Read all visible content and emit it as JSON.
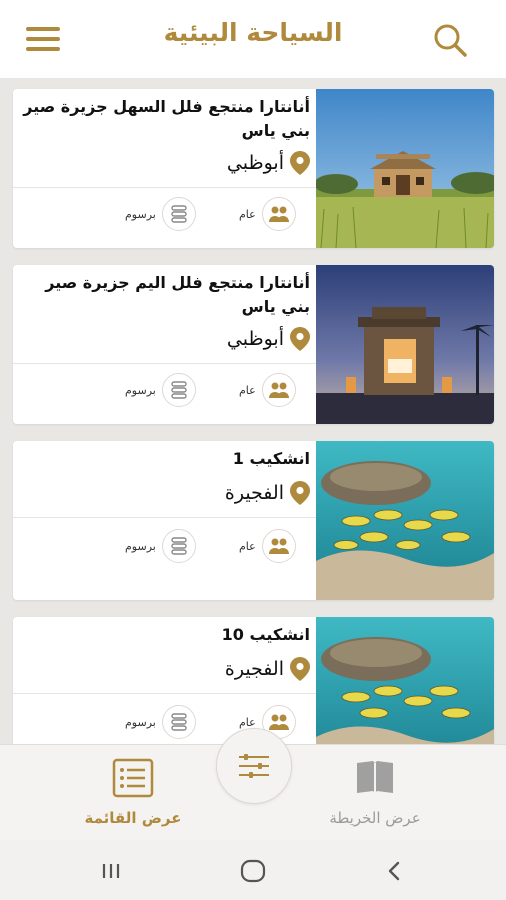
{
  "header": {
    "title": "السياحة البيئية"
  },
  "places": [
    {
      "name": "أنانتارا منتجع فلل السهل جزيرة صير بني ياس",
      "location": "أبوظبي",
      "access": "عام",
      "fees": "برسوم",
      "photo": "desert-villa-day"
    },
    {
      "name": "أنانتارا منتجع فلل اليم جزيرة صير بني ياس",
      "location": "أبوظبي",
      "access": "عام",
      "fees": "برسوم",
      "photo": "beach-villa-night"
    },
    {
      "name": "انشكيب 1",
      "location": "الفجيرة",
      "access": "عام",
      "fees": "برسوم",
      "photo": "coral-reef-fish"
    },
    {
      "name": "انشكيب 10",
      "location": "الفجيرة",
      "access": "عام",
      "fees": "برسوم",
      "photo": "coral-reef-fish"
    }
  ],
  "bottom_tabs": {
    "list_view": "عرض القائمة",
    "map_view": "عرض الخريطة"
  },
  "colors": {
    "accent": "#b08a3c",
    "inactive": "#9a9a9a",
    "background": "#e9e7e4"
  },
  "icons": {
    "menu": "menu-icon",
    "search": "search-icon",
    "location": "location-pin-icon",
    "access": "people-icon",
    "fees": "coins-icon",
    "filter": "filter-sliders-icon",
    "list": "list-icon",
    "map": "map-book-icon"
  }
}
